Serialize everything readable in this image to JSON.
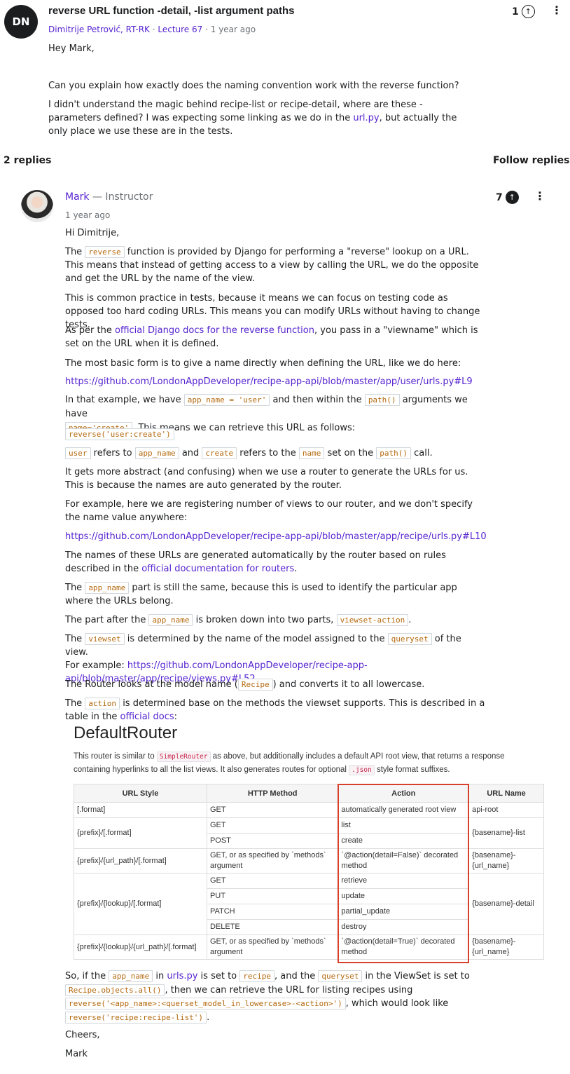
{
  "question": {
    "avatar_initials": "DN",
    "title": "reverse URL function -detail, -list argument paths",
    "author": "Dimitrije Petrović, RT-RK",
    "lecture": "Lecture 67",
    "time": "1 year ago",
    "upvotes": "1",
    "greeting": "Hey Mark,",
    "p1": "Can you explain how exactly does the naming convention work with the reverse function?",
    "p2_a": "I didn't understand the magic behind recipe-list or recipe-detail, where are these -parameters defined? I was expecting some linking as we do in the ",
    "p2_link": "url.py",
    "p2_b": ", but actually the only place we use these are in the tests."
  },
  "replies_bar": {
    "count": "2 replies",
    "follow": "Follow replies"
  },
  "reply": {
    "author": "Mark",
    "role": "— Instructor",
    "time": "1 year ago",
    "upvotes": "7",
    "greeting": "Hi Dimitrije,",
    "r1_a": "The ",
    "r1_code": "reverse",
    "r1_b": " function is provided by Django for performing a \"reverse\" lookup on a URL. This means that instead of getting access to a view by calling the URL, we do the opposite and get the URL by the name of the view.",
    "r2": "This is common practice in tests, because it means we can focus on testing code as opposed too hard coding URLs. This means you can modify URLs without having to change tests.",
    "r3_a": "As per the ",
    "r3_link": "official Django docs for the reverse function",
    "r3_b": ", you pass in a \"viewname\" which is set on the URL when it is defined.",
    "r4": "The most basic form is to give a name directly when defining the URL, like we do here:",
    "link1": "https://github.com/LondonAppDeveloper/recipe-app-api/blob/master/app/user/urls.py#L9",
    "r5_a": "In that example, we have ",
    "r5_c1": "app_name = 'user'",
    "r5_b": " and then within the ",
    "r5_c2": "path()",
    "r5_c": " arguments we have",
    "r5_c3": "name='create'",
    "r5_d": ". This means we can retrieve this URL as follows:",
    "code_block": "reverse('user:create')",
    "r6_c1": "user",
    "r6_a": " refers to ",
    "r6_c2": "app_name",
    "r6_b": " and ",
    "r6_c3": "create",
    "r6_c": " refers to the ",
    "r6_c4": "name",
    "r6_d": " set on the ",
    "r6_c5": "path()",
    "r6_e": " call.",
    "r7": "It gets more abstract (and confusing) when we use a router to generate the URLs for us. This is because the names are auto generated by the router.",
    "r8": "For example, here we are registering number of views to our router, and we don't specify the name value anywhere:",
    "link2": "https://github.com/LondonAppDeveloper/recipe-app-api/blob/master/app/recipe/urls.py#L10",
    "r9_a": "The names of these URLs are generated automatically by the router based on rules described in the ",
    "r9_link": "official documentation for routers",
    "r9_b": ".",
    "r10_a": "The ",
    "r10_c": "app_name",
    "r10_b": " part is still the same, because this is used to identify the particular app where the URLs belong.",
    "r11_a": "The part after the ",
    "r11_c1": "app_name",
    "r11_b": " is broken down into two parts, ",
    "r11_c2": "viewset-action",
    "r11_d": ".",
    "r12_a": "The ",
    "r12_c1": "viewset",
    "r12_b": " is determined by the name of the model assigned to the ",
    "r12_c2": "queryset",
    "r12_c": " of the view.",
    "r12_d": "For example: ",
    "r12_link": "https://github.com/LondonAppDeveloper/recipe-app-api/blob/master/app/recipe/views.py#L52",
    "r13_a": "The Router looks at the model name (",
    "r13_c": "Recipe",
    "r13_b": ") and converts it to all lowercase.",
    "r14_a": "The ",
    "r14_c": "action",
    "r14_b": " is determined base on the methods the viewset supports. This is described in a table in the ",
    "r14_link": "official docs",
    "r14_d": ":",
    "r15_a": "So, if the ",
    "r15_c1": "app_name",
    "r15_b": " in ",
    "r15_link": "urls.py",
    "r15_c": " is set to ",
    "r15_c2": "recipe",
    "r15_d": ", and the ",
    "r15_c3": "queryset",
    "r15_e": " in the ViewSet is set to",
    "r15_c4": "Recipe.objects.all()",
    "r15_f": ", then we can retrieve the URL for listing recipes using",
    "r15_c5": "reverse('<app_name>:<querset_model_in_lowercase>-<action>')",
    "r15_g": ", which would look like",
    "r15_c6": "reverse('recipe:recipe-list')",
    "r15_h": ".",
    "signoff1": "Cheers,",
    "signoff2": "Mark"
  },
  "router_doc": {
    "heading": "DefaultRouter",
    "intro_a": "This router is similar to ",
    "intro_code1": "SimpleRouter",
    "intro_b": " as above, but additionally includes a default API root view, that returns a response containing hyperlinks to all the list views. It also generates routes for optional ",
    "intro_code2": ".json",
    "intro_c": " style format suffixes.",
    "headers": [
      "URL Style",
      "HTTP Method",
      "Action",
      "URL Name"
    ],
    "cells": {
      "u1": "[.format]",
      "m1": "GET",
      "a1": "automatically generated root view",
      "n1": "api-root",
      "u2": "{prefix}/[.format]",
      "m2a": "GET",
      "a2a": "list",
      "m2b": "POST",
      "a2b": "create",
      "n2": "{basename}-list",
      "u3": "{prefix}/{url_path}/[.format]",
      "m3": "GET, or as specified by `methods` argument",
      "a3": "`@action(detail=False)` decorated method",
      "n3": "{basename}-{url_name}",
      "u4": "{prefix}/{lookup}/[.format]",
      "m4a": "GET",
      "a4a": "retrieve",
      "m4b": "PUT",
      "a4b": "update",
      "m4c": "PATCH",
      "a4c": "partial_update",
      "m4d": "DELETE",
      "a4d": "destroy",
      "n4": "{basename}-detail",
      "u5": "{prefix}/{lookup}/{url_path}/[.format]",
      "m5": "GET, or as specified by `methods` argument",
      "a5": "`@action(detail=True)` decorated method",
      "n5": "{basename}-{url_name}"
    }
  }
}
